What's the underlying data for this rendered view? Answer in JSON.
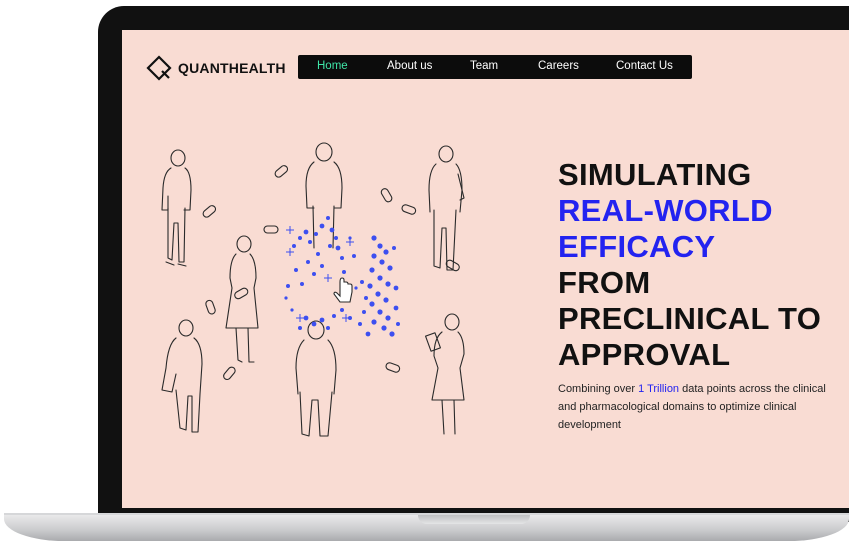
{
  "brand": {
    "name": "QUANTHEALTH",
    "logo_icon": "q-logo-icon"
  },
  "nav": {
    "items": [
      {
        "label": "Home",
        "active": true
      },
      {
        "label": "About us",
        "active": false
      },
      {
        "label": "Team",
        "active": false
      },
      {
        "label": "Careers",
        "active": false
      },
      {
        "label": "Contact Us",
        "active": false
      }
    ],
    "active_color": "#3fe6a8"
  },
  "hero": {
    "line1": "SIMULATING",
    "line2": "REAL-WORLD",
    "line3": "EFFICACY",
    "line4": "FROM",
    "line5": "PRECLINICAL TO",
    "line6": "APPROVAL",
    "sub_before": "Combining over ",
    "sub_highlight": "1 Trillion",
    "sub_after": " data points across the clinical and pharmacological domains to optimize clinical development"
  },
  "colors": {
    "background": "#f9dcd3",
    "accent_blue": "#2323f0",
    "nav_bg": "#0c0c0c"
  },
  "illustration": {
    "icon": "people-data-illustration",
    "cursor_icon": "hand-cursor-icon"
  }
}
